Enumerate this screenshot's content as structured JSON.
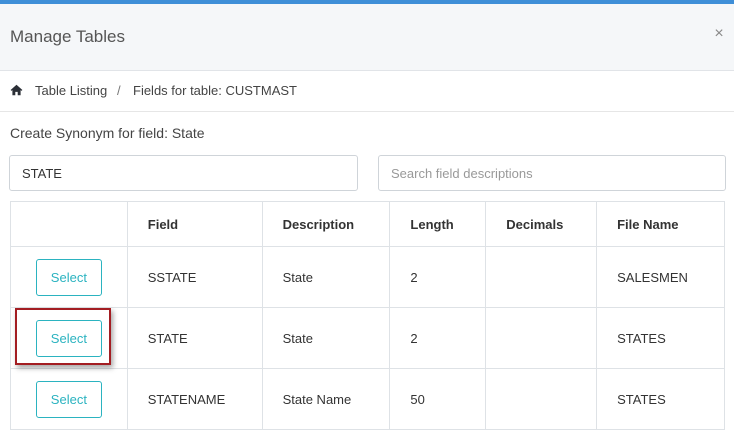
{
  "modal": {
    "title": "Manage Tables",
    "close_glyph": "×"
  },
  "breadcrumb": {
    "home_icon": "home-icon",
    "items": [
      "Table Listing",
      "Fields for table: CUSTMAST"
    ],
    "separator": "/"
  },
  "section_title": "Create Synonym for field: State",
  "synonym_input": {
    "value": "STATE"
  },
  "search_input": {
    "placeholder": "Search field descriptions"
  },
  "table": {
    "headers": [
      "",
      "Field",
      "Description",
      "Length",
      "Decimals",
      "File Name"
    ],
    "rows": [
      {
        "action": "Select",
        "field": "SSTATE",
        "description": "State",
        "length": "2",
        "decimals": "",
        "file_name": "SALESMEN"
      },
      {
        "action": "Select",
        "field": "STATE",
        "description": "State",
        "length": "2",
        "decimals": "",
        "file_name": "STATES"
      },
      {
        "action": "Select",
        "field": "STATENAME",
        "description": "State Name",
        "length": "50",
        "decimals": "",
        "file_name": "STATES"
      }
    ]
  },
  "colors": {
    "accent": "#2bb3c0",
    "top_bar": "#3f8fd8",
    "highlight": "#a31d22"
  }
}
